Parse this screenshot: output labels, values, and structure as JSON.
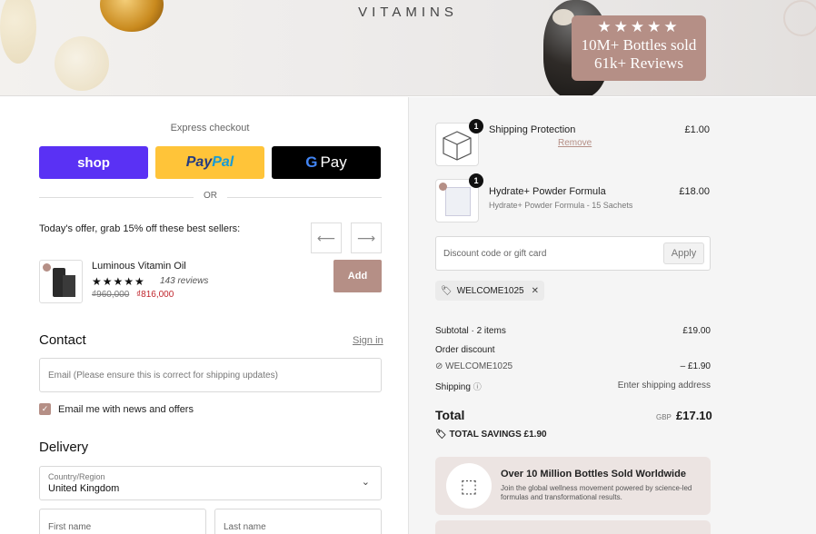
{
  "banner": {
    "brand": "VITAMINS",
    "stars": "★★★★★",
    "line1": "10M+ Bottles sold",
    "line2": "61k+ Reviews",
    "accent_color": "#b58f86"
  },
  "express": {
    "title": "Express checkout",
    "shop_label": "shop",
    "paypal_a": "Pay",
    "paypal_b": "Pal",
    "gpay_g": "G",
    "gpay_label": "Pay",
    "or": "OR"
  },
  "offer": {
    "title": "Today's offer, grab 15% off these best sellers:",
    "prev_icon": "arrow-left-icon",
    "next_icon": "arrow-right-icon",
    "product": {
      "name": "Luminous Vitamin Oil",
      "stars": "★★★★★",
      "reviews": "143 reviews",
      "old_price": "₫960,000",
      "new_price": "₫816,000",
      "add_label": "Add"
    }
  },
  "contact": {
    "title": "Contact",
    "signin": "Sign in",
    "email_placeholder": "Email (Please ensure this is correct for shipping updates)",
    "newsletter_label": "Email me with news and offers",
    "newsletter_checked": true
  },
  "delivery": {
    "title": "Delivery",
    "country_label": "Country/Region",
    "country_value": "United Kingdom",
    "first_name_placeholder": "First name",
    "last_name_placeholder": "Last name"
  },
  "order": {
    "items": [
      {
        "qty": "1",
        "name": "Shipping Protection",
        "price": "£1.00",
        "remove": "Remove"
      },
      {
        "qty": "1",
        "name": "Hydrate+ Powder Formula",
        "sub": "Hydrate+ Powder Formula - 15 Sachets",
        "price": "£18.00"
      }
    ],
    "discount_placeholder": "Discount code or gift card",
    "apply_label": "Apply",
    "applied_code": "WELCOME1025",
    "subtotal_label": "Subtotal · 2 items",
    "subtotal_value": "£19.00",
    "order_discount_label": "Order discount",
    "discount_code": "WELCOME1025",
    "discount_value": "– £1.90",
    "shipping_label": "Shipping",
    "shipping_value": "Enter shipping address",
    "total_label": "Total",
    "currency": "GBP",
    "total_value": "£17.10",
    "savings_label": "TOTAL SAVINGS",
    "savings_value": "£1.90",
    "promo_title": "Over 10 Million Bottles Sold Worldwide",
    "promo_text": "Join the global wellness movement powered by science-led formulas and transformational results."
  }
}
